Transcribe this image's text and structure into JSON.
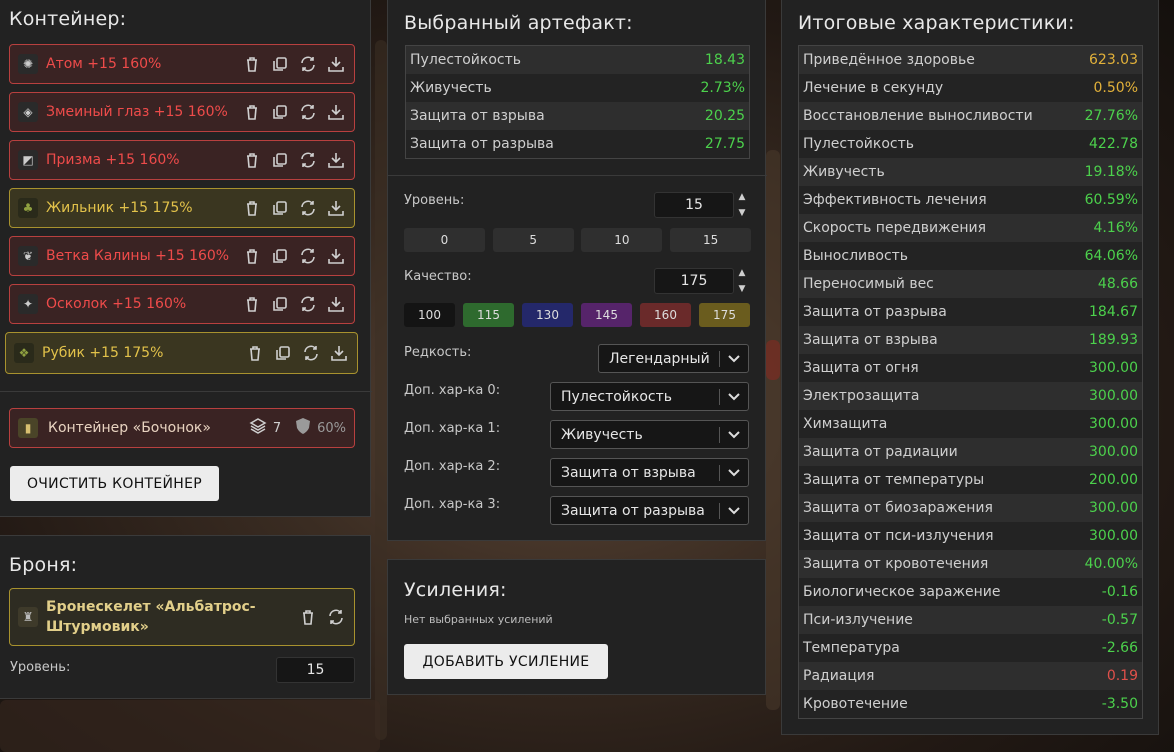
{
  "container": {
    "title": "Контейнер:",
    "items": [
      {
        "label": "Атом +15 160%",
        "tier": "red",
        "icon": "atom-icon"
      },
      {
        "label": "Змеиный глаз +15 160%",
        "tier": "red",
        "icon": "snake-eye-icon"
      },
      {
        "label": "Призма +15 160%",
        "tier": "red",
        "icon": "prism-icon"
      },
      {
        "label": "Жильник +15 175%",
        "tier": "gold",
        "icon": "zhilnik-icon"
      },
      {
        "label": "Ветка Калины +15 160%",
        "tier": "red",
        "icon": "kalina-branch-icon"
      },
      {
        "label": "Осколок +15 160%",
        "tier": "red",
        "icon": "shard-icon"
      },
      {
        "label": "Рубик +15 175%",
        "tier": "gold",
        "icon": "rubik-icon"
      }
    ],
    "box": {
      "label": "Контейнер «Бочонок»",
      "slots": "7",
      "protection": "60%"
    },
    "clear_button": "ОЧИСТИТЬ КОНТЕЙНЕР"
  },
  "armor": {
    "title": "Броня:",
    "name_line1": "Бронескелет «Альбатрос-",
    "name_line2": "Штурмовик»",
    "level_label": "Уровень:",
    "level": "15"
  },
  "artifact": {
    "title": "Выбранный артефакт:",
    "stats": [
      {
        "name": "Пулестойкость",
        "value": "18.43"
      },
      {
        "name": "Живучесть",
        "value": "2.73%"
      },
      {
        "name": "Защита от взрыва",
        "value": "20.25"
      },
      {
        "name": "Защита от разрыва",
        "value": "27.75"
      }
    ],
    "level_label": "Уровень:",
    "level": "15",
    "level_presets": [
      "0",
      "5",
      "10",
      "15"
    ],
    "quality_label": "Качество:",
    "quality": "175",
    "quality_presets": [
      {
        "v": "100",
        "c": "#141414"
      },
      {
        "v": "115",
        "c": "#2e6a2e"
      },
      {
        "v": "130",
        "c": "#24286a"
      },
      {
        "v": "145",
        "c": "#56246a"
      },
      {
        "v": "160",
        "c": "#6a2a2a"
      },
      {
        "v": "175",
        "c": "#6a5c1e"
      }
    ],
    "rarity_label": "Редкость:",
    "rarity": "Легендарный",
    "extras": [
      {
        "label": "Доп. хар-ка 0:",
        "value": "Пулестойкость"
      },
      {
        "label": "Доп. хар-ка 1:",
        "value": "Живучесть"
      },
      {
        "label": "Доп. хар-ка 2:",
        "value": "Защита от взрыва"
      },
      {
        "label": "Доп. хар-ка 3:",
        "value": "Защита от разрыва"
      }
    ]
  },
  "boosts": {
    "title": "Усиления:",
    "empty": "Нет выбранных усилений",
    "add_button": "ДОБАВИТЬ УСИЛЕНИЕ"
  },
  "totals": {
    "title": "Итоговые характеристики:",
    "stats": [
      {
        "name": "Приведённое здоровье",
        "value": "623.03",
        "c": "y"
      },
      {
        "name": "Лечение в секунду",
        "value": "0.50%",
        "c": "y"
      },
      {
        "name": "Восстановление выносливости",
        "value": "27.76%",
        "c": "g"
      },
      {
        "name": "Пулестойкость",
        "value": "422.78",
        "c": "g"
      },
      {
        "name": "Живучесть",
        "value": "19.18%",
        "c": "g"
      },
      {
        "name": "Эффективность лечения",
        "value": "60.59%",
        "c": "g"
      },
      {
        "name": "Скорость передвижения",
        "value": "4.16%",
        "c": "g"
      },
      {
        "name": "Выносливость",
        "value": "64.06%",
        "c": "g"
      },
      {
        "name": "Переносимый вес",
        "value": "48.66",
        "c": "g"
      },
      {
        "name": "Защита от разрыва",
        "value": "184.67",
        "c": "g"
      },
      {
        "name": "Защита от взрыва",
        "value": "189.93",
        "c": "g"
      },
      {
        "name": "Защита от огня",
        "value": "300.00",
        "c": "g"
      },
      {
        "name": "Электрозащита",
        "value": "300.00",
        "c": "g"
      },
      {
        "name": "Химзащита",
        "value": "300.00",
        "c": "g"
      },
      {
        "name": "Защита от радиации",
        "value": "300.00",
        "c": "g"
      },
      {
        "name": "Защита от температуры",
        "value": "200.00",
        "c": "g"
      },
      {
        "name": "Защита от биозаражения",
        "value": "300.00",
        "c": "g"
      },
      {
        "name": "Защита от пси-излучения",
        "value": "300.00",
        "c": "g"
      },
      {
        "name": "Защита от кровотечения",
        "value": "40.00%",
        "c": "g"
      },
      {
        "name": "Биологическое заражение",
        "value": "-0.16",
        "c": "g"
      },
      {
        "name": "Пси-излучение",
        "value": "-0.57",
        "c": "g"
      },
      {
        "name": "Температура",
        "value": "-2.66",
        "c": "g"
      },
      {
        "name": "Радиация",
        "value": "0.19",
        "c": "r"
      },
      {
        "name": "Кровотечение",
        "value": "-3.50",
        "c": "g"
      }
    ]
  }
}
